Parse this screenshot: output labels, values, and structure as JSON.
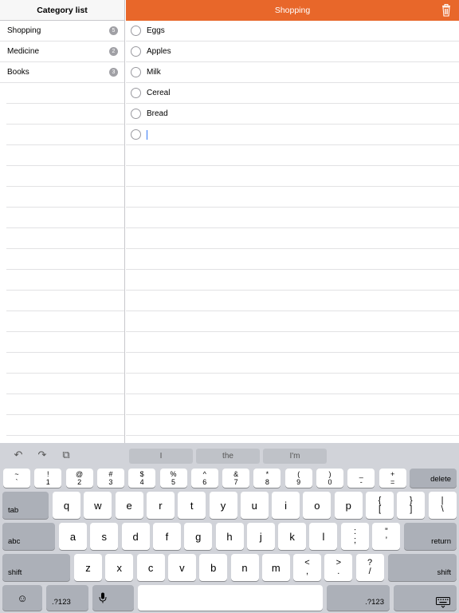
{
  "sidebar": {
    "title": "Category list",
    "items": [
      {
        "label": "Shopping",
        "count": "5"
      },
      {
        "label": "Medicine",
        "count": "2"
      },
      {
        "label": "Books",
        "count": "3"
      }
    ]
  },
  "main": {
    "title": "Shopping",
    "items": [
      "Eggs",
      "Apples",
      "Milk",
      "Cereal",
      "Bread"
    ]
  },
  "colors": {
    "accent": "#e8672a"
  },
  "keyboard": {
    "suggestions": [
      "I",
      "the",
      "I'm"
    ],
    "row1": [
      {
        "top": "~",
        "bottom": "`"
      },
      {
        "top": "!",
        "bottom": "1"
      },
      {
        "top": "@",
        "bottom": "2"
      },
      {
        "top": "#",
        "bottom": "3"
      },
      {
        "top": "$",
        "bottom": "4"
      },
      {
        "top": "%",
        "bottom": "5"
      },
      {
        "top": "^",
        "bottom": "6"
      },
      {
        "top": "&",
        "bottom": "7"
      },
      {
        "top": "*",
        "bottom": "8"
      },
      {
        "top": "(",
        "bottom": "9"
      },
      {
        "top": ")",
        "bottom": "0"
      },
      {
        "top": "_",
        "bottom": "-"
      },
      {
        "top": "+",
        "bottom": "="
      }
    ],
    "delete": "delete",
    "tab": "tab",
    "row2": [
      "q",
      "w",
      "e",
      "r",
      "t",
      "y",
      "u",
      "i",
      "o",
      "p"
    ],
    "row2_extra": [
      {
        "top": "{",
        "bottom": "["
      },
      {
        "top": "}",
        "bottom": "]"
      },
      {
        "top": "|",
        "bottom": "\\"
      }
    ],
    "abc": "abc",
    "row3": [
      "a",
      "s",
      "d",
      "f",
      "g",
      "h",
      "j",
      "k",
      "l"
    ],
    "row3_extra": [
      {
        "top": ":",
        "bottom": ";"
      },
      {
        "top": "”",
        "bottom": "’"
      }
    ],
    "return": "return",
    "shift": "shift",
    "row4": [
      "z",
      "x",
      "c",
      "v",
      "b",
      "n",
      "m"
    ],
    "row4_extra": [
      {
        "top": "<",
        "bottom": ","
      },
      {
        "top": ">",
        "bottom": "."
      },
      {
        "top": "?",
        "bottom": "/"
      }
    ],
    "numbers": ".?123"
  }
}
